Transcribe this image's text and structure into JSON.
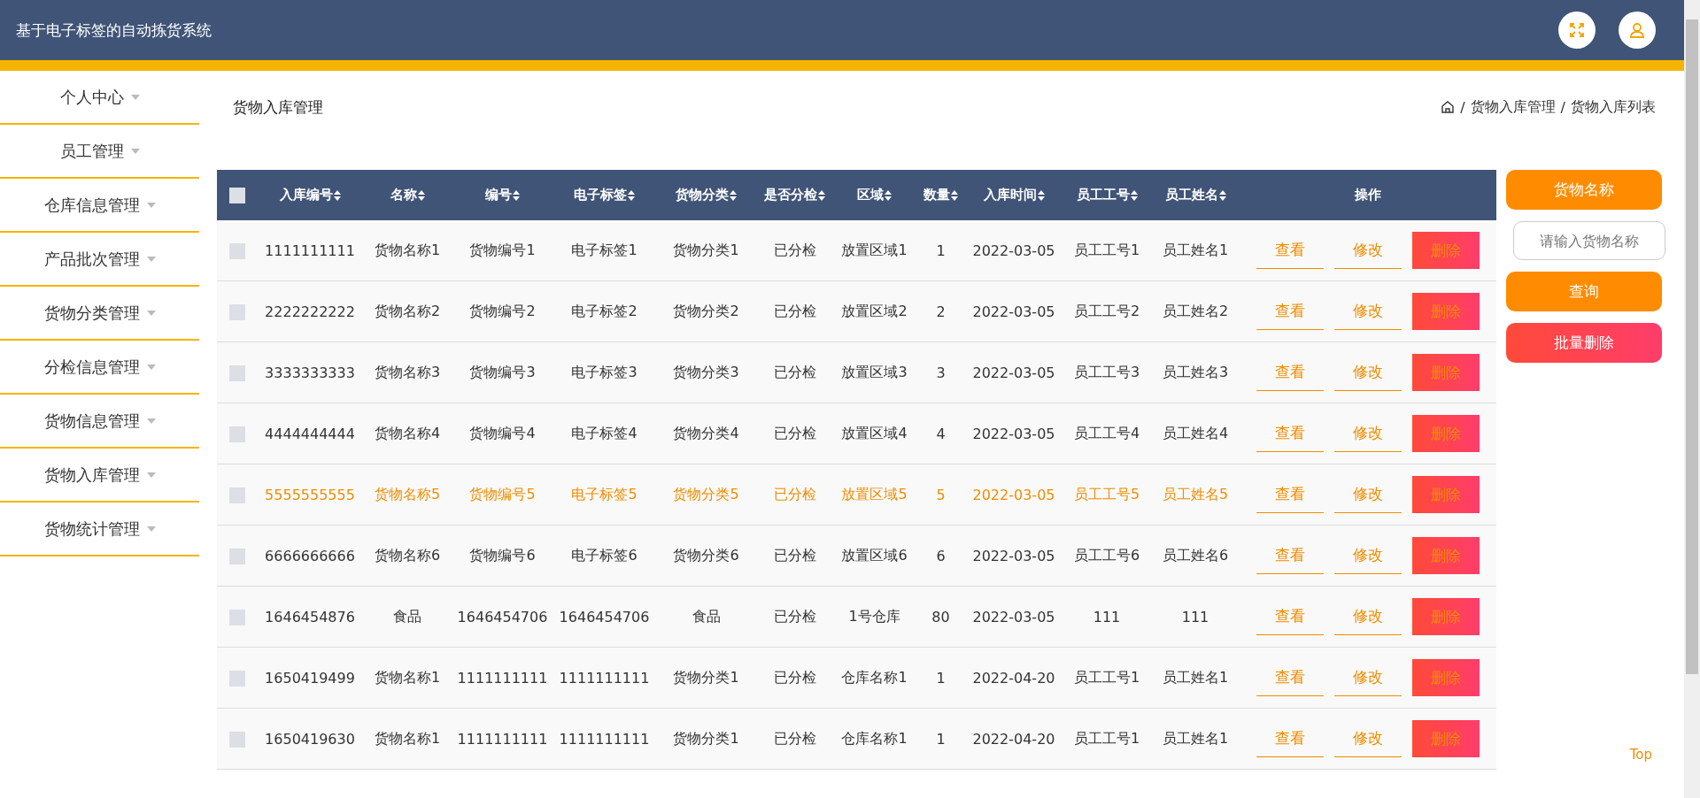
{
  "header": {
    "title": "基于电子标签的自动拣货系统"
  },
  "sidebar": {
    "items": [
      {
        "label": "个人中心"
      },
      {
        "label": "员工管理"
      },
      {
        "label": "仓库信息管理"
      },
      {
        "label": "产品批次管理"
      },
      {
        "label": "货物分类管理"
      },
      {
        "label": "分检信息管理"
      },
      {
        "label": "货物信息管理"
      },
      {
        "label": "货物入库管理"
      },
      {
        "label": "货物统计管理"
      }
    ]
  },
  "page_title": "货物入库管理",
  "breadcrumb": [
    {
      "separator": "/",
      "label": "货物入库管理"
    },
    {
      "separator": "/",
      "label": "货物入库列表"
    }
  ],
  "table": {
    "select_all": {
      "checked": false
    },
    "columns": [
      {
        "label": "入库编号",
        "sortable": true
      },
      {
        "label": "名称",
        "sortable": true
      },
      {
        "label": "编号",
        "sortable": true
      },
      {
        "label": "电子标签",
        "sortable": true
      },
      {
        "label": "货物分类",
        "sortable": true
      },
      {
        "label": "是否分检",
        "sortable": true
      },
      {
        "label": "区域",
        "sortable": true
      },
      {
        "label": "数量",
        "sortable": true
      },
      {
        "label": "入库时间",
        "sortable": true
      },
      {
        "label": "员工工号",
        "sortable": true
      },
      {
        "label": "员工姓名",
        "sortable": true
      },
      {
        "label": "操作",
        "sortable": false
      }
    ],
    "rows": [
      {
        "checked": false,
        "highlighted": false,
        "cells": [
          "1111111111",
          "货物名称1",
          "货物编号1",
          "电子标签1",
          "货物分类1",
          "已分检",
          "放置区域1",
          "1",
          "2022-03-05",
          "员工工号1",
          "员工姓名1"
        ],
        "actions": [
          "查看",
          "修改",
          "删除"
        ]
      },
      {
        "checked": false,
        "highlighted": false,
        "cells": [
          "2222222222",
          "货物名称2",
          "货物编号2",
          "电子标签2",
          "货物分类2",
          "已分检",
          "放置区域2",
          "2",
          "2022-03-05",
          "员工工号2",
          "员工姓名2"
        ],
        "actions": [
          "查看",
          "修改",
          "删除"
        ]
      },
      {
        "checked": false,
        "highlighted": false,
        "cells": [
          "3333333333",
          "货物名称3",
          "货物编号3",
          "电子标签3",
          "货物分类3",
          "已分检",
          "放置区域3",
          "3",
          "2022-03-05",
          "员工工号3",
          "员工姓名3"
        ],
        "actions": [
          "查看",
          "修改",
          "删除"
        ]
      },
      {
        "checked": false,
        "highlighted": false,
        "cells": [
          "4444444444",
          "货物名称4",
          "货物编号4",
          "电子标签4",
          "货物分类4",
          "已分检",
          "放置区域4",
          "4",
          "2022-03-05",
          "员工工号4",
          "员工姓名4"
        ],
        "actions": [
          "查看",
          "修改",
          "删除"
        ]
      },
      {
        "checked": false,
        "highlighted": true,
        "cells": [
          "5555555555",
          "货物名称5",
          "货物编号5",
          "电子标签5",
          "货物分类5",
          "已分检",
          "放置区域5",
          "5",
          "2022-03-05",
          "员工工号5",
          "员工姓名5"
        ],
        "actions": [
          "查看",
          "修改",
          "删除"
        ]
      },
      {
        "checked": false,
        "highlighted": false,
        "cells": [
          "6666666666",
          "货物名称6",
          "货物编号6",
          "电子标签6",
          "货物分类6",
          "已分检",
          "放置区域6",
          "6",
          "2022-03-05",
          "员工工号6",
          "员工姓名6"
        ],
        "actions": [
          "查看",
          "修改",
          "删除"
        ]
      },
      {
        "checked": false,
        "highlighted": false,
        "cells": [
          "1646454876",
          "食品",
          "1646454706",
          "1646454706",
          "食品",
          "已分检",
          "1号仓库",
          "80",
          "2022-03-05",
          "111",
          "111"
        ],
        "actions": [
          "查看",
          "修改",
          "删除"
        ]
      },
      {
        "checked": false,
        "highlighted": false,
        "cells": [
          "1650419499",
          "货物名称1",
          "1111111111",
          "1111111111",
          "货物分类1",
          "已分检",
          "仓库名称1",
          "1",
          "2022-04-20",
          "员工工号1",
          "员工姓名1"
        ],
        "actions": [
          "查看",
          "修改",
          "删除"
        ]
      },
      {
        "checked": false,
        "highlighted": false,
        "cells": [
          "1650419630",
          "货物名称1",
          "1111111111",
          "1111111111",
          "货物分类1",
          "已分检",
          "仓库名称1",
          "1",
          "2022-04-20",
          "员工工号1",
          "员工姓名1"
        ],
        "actions": [
          "查看",
          "修改",
          "删除"
        ]
      }
    ]
  },
  "search_panel": {
    "field_label": "货物名称",
    "placeholder": "请输入货物名称",
    "search_button": "查询",
    "batch_delete_button": "批量删除"
  },
  "back_to_top": "Top"
}
